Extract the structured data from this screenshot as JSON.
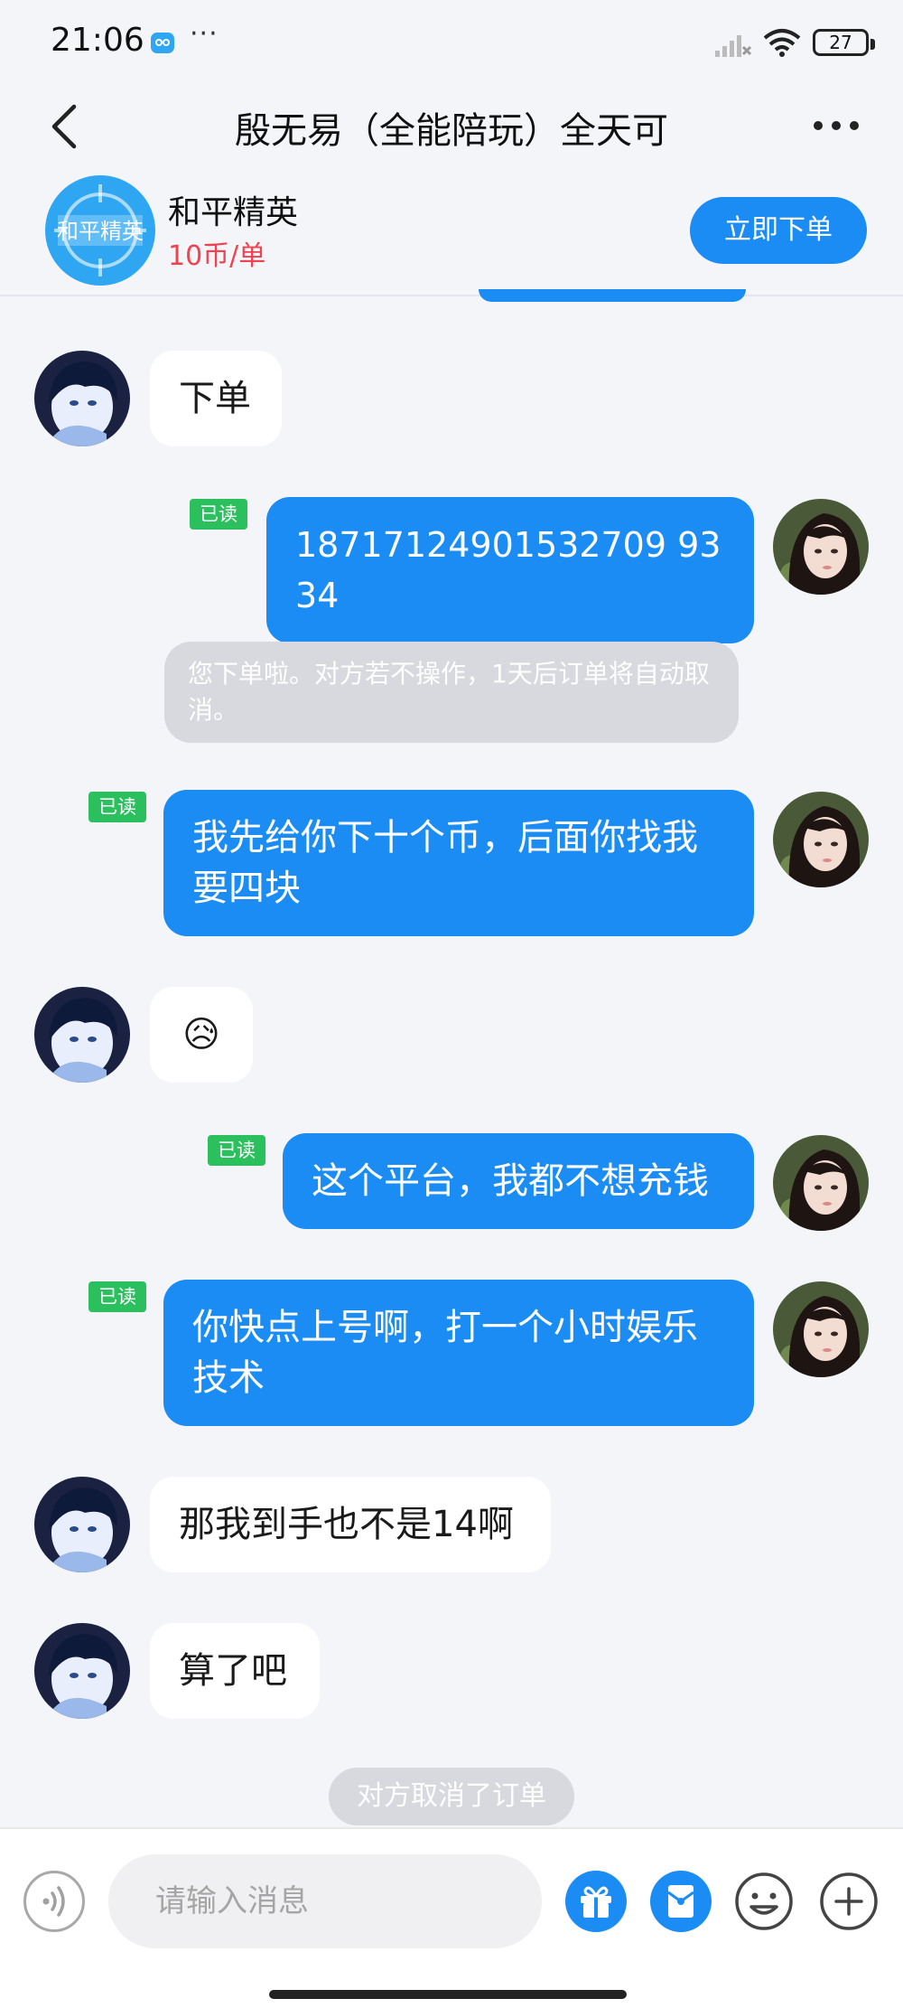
{
  "status_bar": {
    "time": "21:06",
    "more": "···",
    "battery": "27"
  },
  "nav": {
    "title": "殷无易（全能陪玩）全天可"
  },
  "product": {
    "logo_text": "和平精英",
    "name": "和平精英",
    "price": "10币/单",
    "order_button": "立即下单"
  },
  "messages": {
    "m1": "下单",
    "m2": "18717124901532709 9334",
    "m3": "我先给你下十个币，后面你找我要四块",
    "m4": "😥",
    "m5": "这个平台，我都不想充钱",
    "m6": "你快点上号啊，打一个小时娱乐技术",
    "m7": "那我到手也不是14啊",
    "m8": "算了吧"
  },
  "read_label": "已读",
  "system_note": "您下单啦。对方若不操作，1天后订单将自动取消。",
  "cancel_note": "对方取消了订单",
  "input": {
    "placeholder": "请输入消息"
  },
  "colors": {
    "accent": "#1a8cf4",
    "read_badge": "#2bbf5e",
    "price": "#f0424f",
    "background": "#f3f5f9"
  },
  "icons": {
    "back": "back-icon",
    "more": "more-icon",
    "voice": "voice-icon",
    "gift": "gift-icon",
    "redpacket": "red-packet-icon",
    "emoji": "emoji-icon",
    "plus": "plus-icon"
  }
}
